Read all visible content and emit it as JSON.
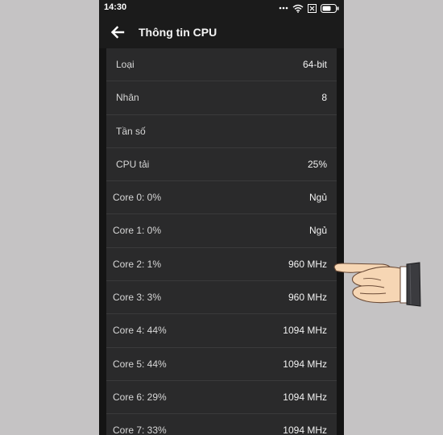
{
  "status_bar": {
    "time": "14:30",
    "icons": [
      "more-dots-icon",
      "wifi-icon",
      "close-box-icon",
      "battery-icon"
    ]
  },
  "toolbar": {
    "back_icon": "arrow-left-icon",
    "title": "Thông tin CPU"
  },
  "cpu_info": {
    "rows": [
      {
        "label": "Loại",
        "value": "64-bit"
      },
      {
        "label": "Nhân",
        "value": "8"
      },
      {
        "label": "Tần số",
        "value": ""
      },
      {
        "label": "CPU tải",
        "value": "25%"
      }
    ],
    "cores": [
      {
        "label": "Core 0: 0%",
        "value": "Ngủ"
      },
      {
        "label": "Core 1: 0%",
        "value": "Ngủ"
      },
      {
        "label": "Core 2: 1%",
        "value": "960 MHz"
      },
      {
        "label": "Core 3: 3%",
        "value": "960 MHz"
      },
      {
        "label": "Core 4: 44%",
        "value": "1094 MHz"
      },
      {
        "label": "Core 5: 44%",
        "value": "1094 MHz"
      },
      {
        "label": "Core 6: 29%",
        "value": "1094 MHz"
      },
      {
        "label": "Core 7: 33%",
        "value": "1094 MHz"
      }
    ]
  },
  "colors": {
    "page_background": "#c5c3c4",
    "screen_background": "#141414",
    "list_background": "#2a2a2b",
    "divider": "#3a3a3b",
    "text": "#d7d7d7"
  },
  "overlay": {
    "icon": "pointing-hand-icon"
  }
}
